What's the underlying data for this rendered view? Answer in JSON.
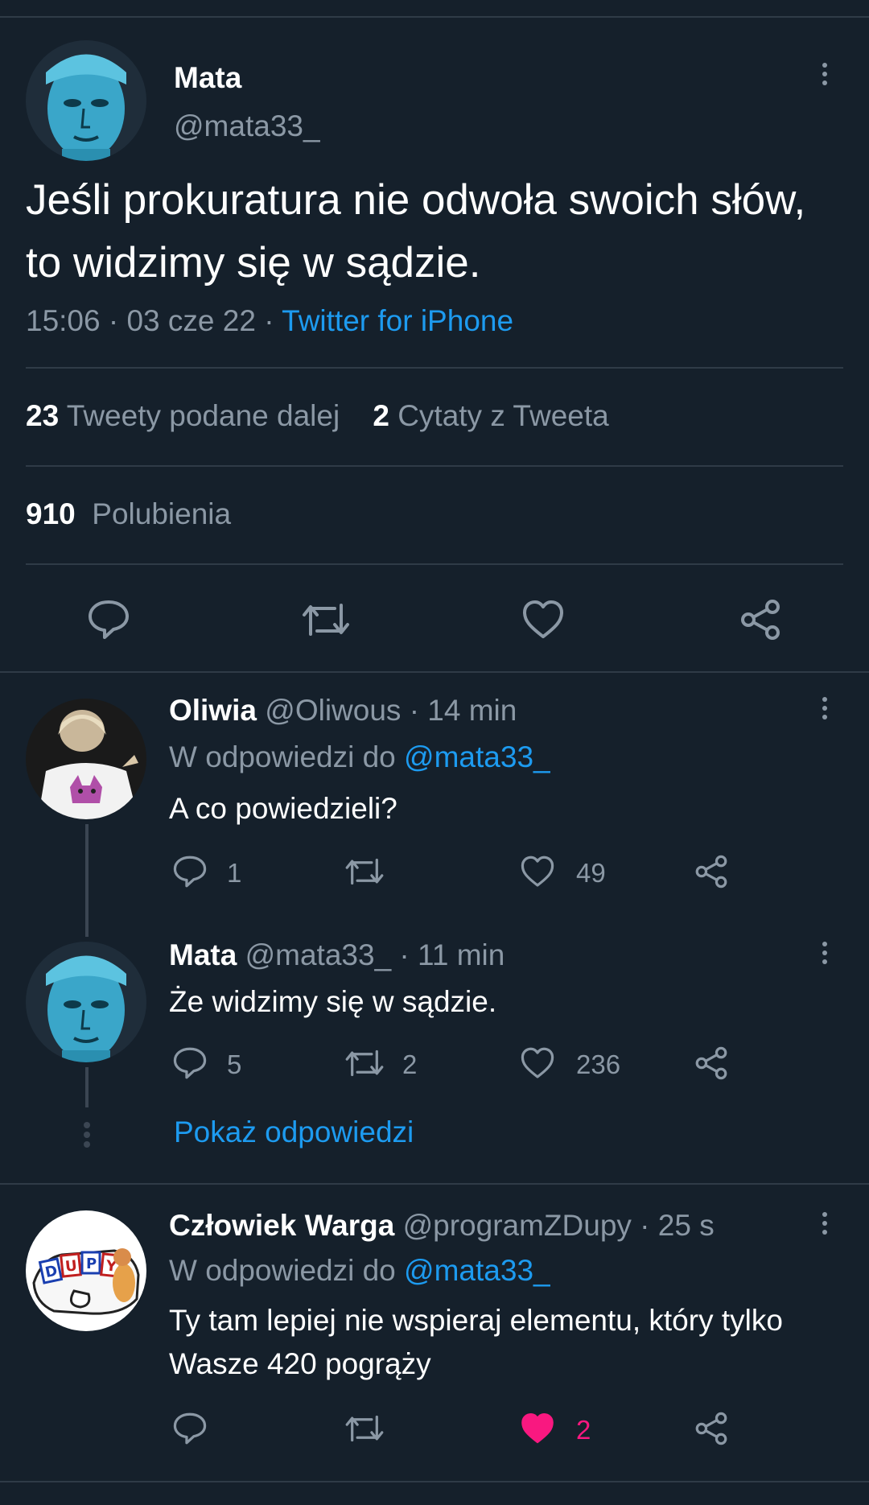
{
  "main_tweet": {
    "author_name": "Mata",
    "author_handle": "@mata33_",
    "text": "Jeśli prokuratura nie odwoła swoich słów, to widzimy się w sądzie.",
    "time": "15:06 · 03 cze 22 · ",
    "source": "Twitter for iPhone",
    "retweets_count": "23",
    "retweets_label": "Tweety podane dalej",
    "quotes_count": "2",
    "quotes_label": "Cytaty z Tweeta",
    "likes_count": "910",
    "likes_label": "Polubienia"
  },
  "replies": [
    {
      "name": "Oliwia",
      "handle_time": "@Oliwous · 14 min",
      "reply_to_prefix": "W odpowiedzi do",
      "reply_to": "@mata33_",
      "text": "A co powiedzieli?",
      "reply_count": "1",
      "retweet_count": "",
      "like_count": "49"
    },
    {
      "name": "Mata",
      "handle_time": "@mata33_ · 11 min",
      "text": "Że widzimy się w sądzie.",
      "reply_count": "5",
      "retweet_count": "2",
      "like_count": "236"
    },
    {
      "name": "Człowiek Warga",
      "handle_time": "@programZDupy · 25 s",
      "reply_to_prefix": "W odpowiedzi do",
      "reply_to": "@mata33_",
      "text": "Ty tam lepiej nie wspieraj elementu, który tylko Wasze 420 pogrąży",
      "reply_count": "",
      "retweet_count": "",
      "like_count": "2",
      "liked": true
    }
  ],
  "show_replies_label": "Pokaż odpowiedzi",
  "avatar_badge_text": "DUPY",
  "colors": {
    "background": "#15202b",
    "accent": "#1d9bf0",
    "muted": "#8b98a5",
    "divider": "#2f3b47",
    "like": "#f91880"
  },
  "icons": [
    "reply-icon",
    "retweet-icon",
    "like-icon",
    "share-icon",
    "more-icon"
  ]
}
